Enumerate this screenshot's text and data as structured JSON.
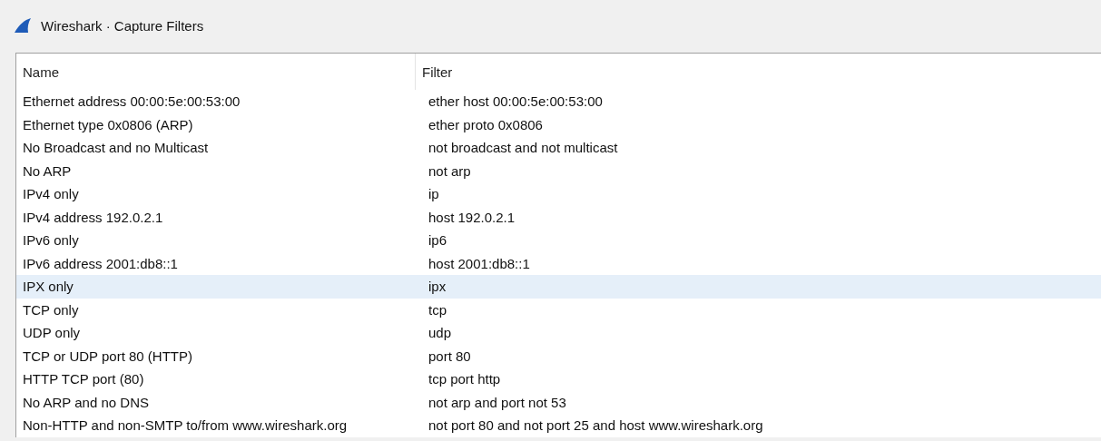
{
  "window": {
    "title": "Wireshark · Capture Filters"
  },
  "table": {
    "columns": [
      "Name",
      "Filter"
    ],
    "rows": [
      {
        "name": "Ethernet address 00:00:5e:00:53:00",
        "filter": "ether host 00:00:5e:00:53:00",
        "selected": false
      },
      {
        "name": "Ethernet type 0x0806 (ARP)",
        "filter": "ether proto 0x0806",
        "selected": false
      },
      {
        "name": "No Broadcast and no Multicast",
        "filter": "not broadcast and not multicast",
        "selected": false
      },
      {
        "name": "No ARP",
        "filter": "not arp",
        "selected": false
      },
      {
        "name": "IPv4 only",
        "filter": "ip",
        "selected": false
      },
      {
        "name": "IPv4 address 192.0.2.1",
        "filter": "host 192.0.2.1",
        "selected": false
      },
      {
        "name": "IPv6 only",
        "filter": "ip6",
        "selected": false
      },
      {
        "name": "IPv6 address 2001:db8::1",
        "filter": "host 2001:db8::1",
        "selected": false
      },
      {
        "name": "IPX only",
        "filter": "ipx",
        "selected": true
      },
      {
        "name": "TCP only",
        "filter": "tcp",
        "selected": false
      },
      {
        "name": "UDP only",
        "filter": "udp",
        "selected": false
      },
      {
        "name": "TCP or UDP port 80 (HTTP)",
        "filter": "port 80",
        "selected": false
      },
      {
        "name": "HTTP TCP port (80)",
        "filter": "tcp port http",
        "selected": false
      },
      {
        "name": "No ARP and no DNS",
        "filter": "not arp and port not 53",
        "selected": false
      },
      {
        "name": "Non-HTTP and non-SMTP to/from www.wireshark.org",
        "filter": "not port 80 and not port 25 and host www.wireshark.org",
        "selected": false
      }
    ]
  }
}
